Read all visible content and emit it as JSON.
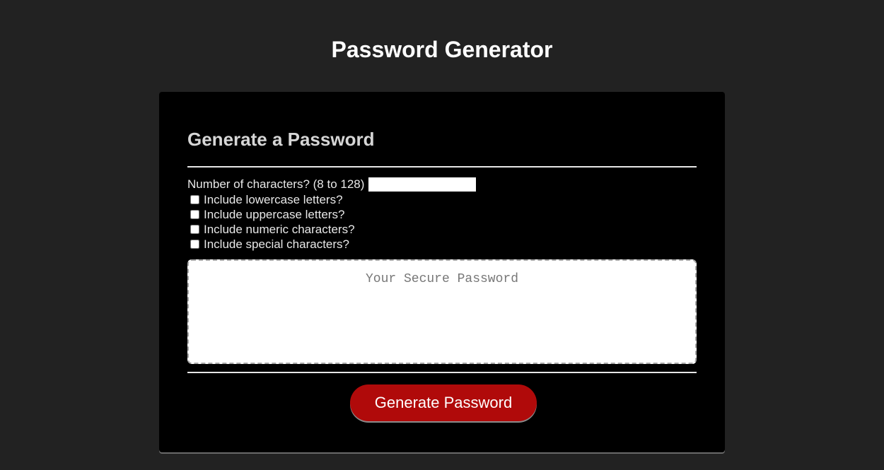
{
  "page": {
    "title": "Password Generator"
  },
  "card": {
    "title": "Generate a Password",
    "length_label": "Number of characters? (8 to 128)",
    "length_value": "",
    "options": [
      {
        "label": "Include lowercase letters?",
        "checked": false
      },
      {
        "label": "Include uppercase letters?",
        "checked": false
      },
      {
        "label": "Include numeric characters?",
        "checked": false
      },
      {
        "label": "Include special characters?",
        "checked": false
      }
    ],
    "password_placeholder": "Your Secure Password",
    "password_value": "",
    "generate_label": "Generate Password"
  },
  "colors": {
    "background": "#222222",
    "card": "#000000",
    "accent": "#b00a0a"
  }
}
